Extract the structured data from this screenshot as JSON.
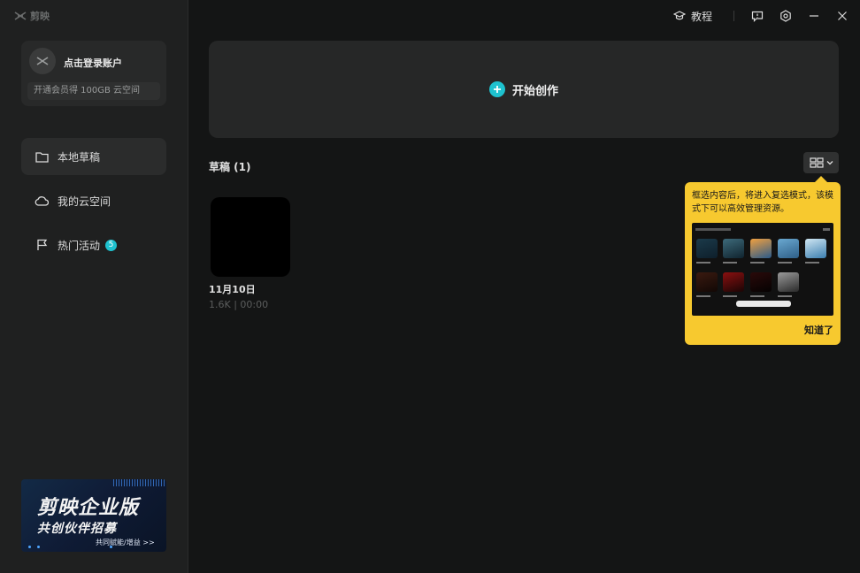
{
  "app": {
    "name": "剪映"
  },
  "account": {
    "login_label": "点击登录账户",
    "vip_label": "开通会员得 100GB 云空间"
  },
  "nav": {
    "local_drafts": "本地草稿",
    "cloud_space": "我的云空间",
    "hot_events": "热门活动",
    "hot_events_badge": "5"
  },
  "promo": {
    "title": "剪映企业版",
    "subtitle": "共创伙伴招募",
    "cta": "共同赋能/增益 >>"
  },
  "titlebar": {
    "tutorial_label": "教程"
  },
  "main": {
    "start_create_label": "开始创作",
    "drafts_header": "草稿 (1)",
    "drafts": [
      {
        "title": "11月10日",
        "meta": "1.6K | 00:00"
      }
    ]
  },
  "tooltip": {
    "text": "框选内容后，将进入复选模式，该模式下可以高效管理资源。",
    "ok_label": "知道了"
  },
  "colors": {
    "accent": "#1ec2cf",
    "tooltip_bg": "#f7c92f",
    "sidebar_bg": "#1f2020",
    "main_bg": "#141515"
  }
}
